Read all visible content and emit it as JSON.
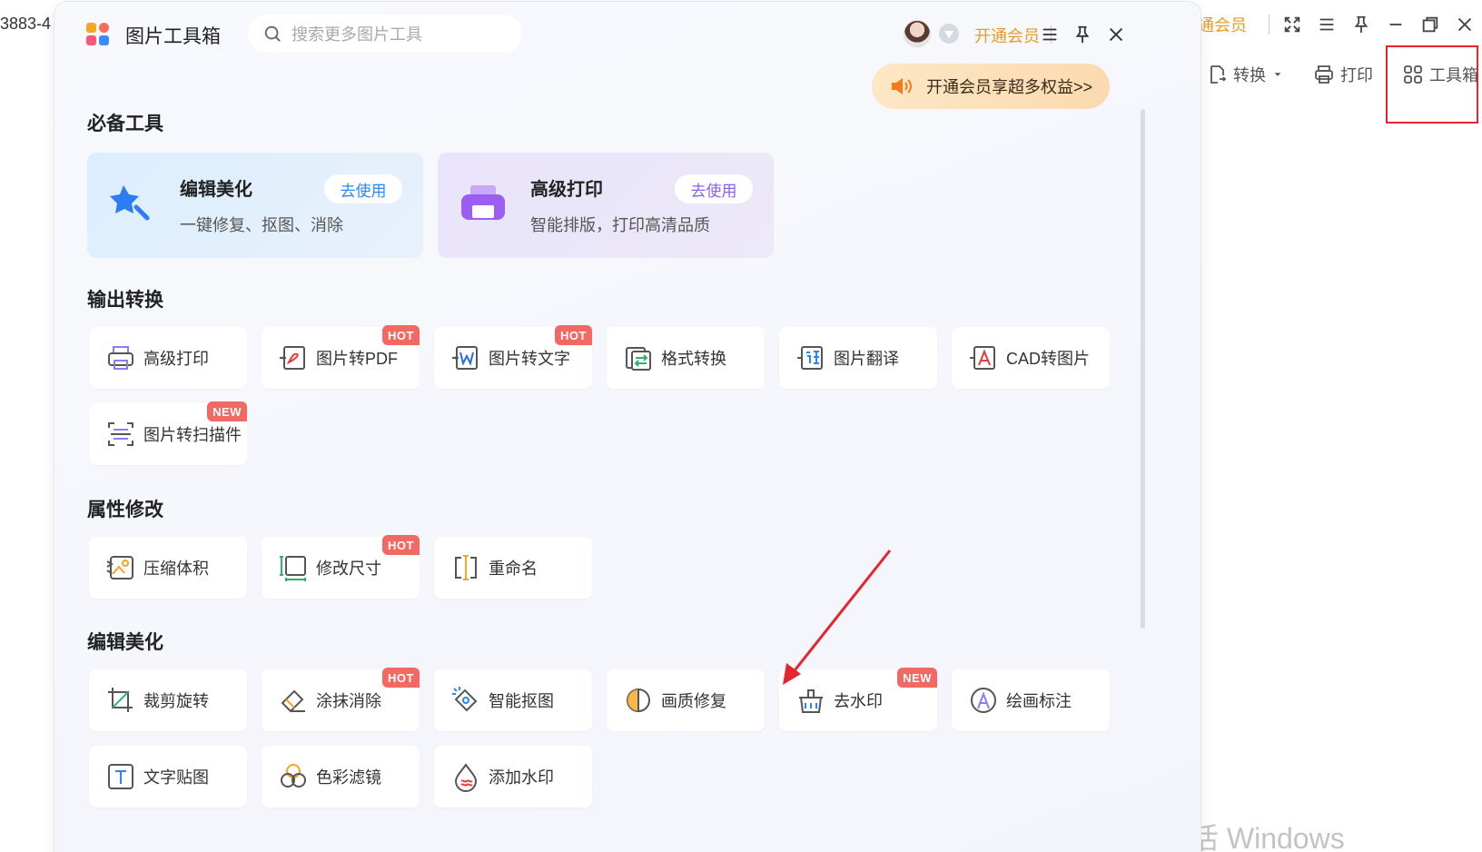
{
  "background": {
    "tab_text": "3883-4",
    "vip_label": "开通会员",
    "tools": [
      {
        "label": "转换",
        "icon": "convert-icon"
      },
      {
        "label": "打印",
        "icon": "printer-icon"
      },
      {
        "label": "工具箱",
        "icon": "toolbox-grid-icon"
      }
    ],
    "watermark": "激活 Windows"
  },
  "panel": {
    "title": "图片工具箱",
    "search_placeholder": "搜索更多图片工具",
    "vip_link": "开通会员",
    "promo": "开通会员享超多权益>>"
  },
  "sections": {
    "essential": "必备工具",
    "output": "输出转换",
    "attributes": "属性修改",
    "edit": "编辑美化"
  },
  "cards": [
    {
      "title": "编辑美化",
      "sub": "一键修复、抠图、消除",
      "button": "去使用"
    },
    {
      "title": "高级打印",
      "sub": "智能排版，打印高清品质",
      "button": "去使用"
    }
  ],
  "output_tools": [
    {
      "label": "高级打印",
      "badge": ""
    },
    {
      "label": "图片转PDF",
      "badge": "HOT"
    },
    {
      "label": "图片转文字",
      "badge": "HOT"
    },
    {
      "label": "格式转换",
      "badge": ""
    },
    {
      "label": "图片翻译",
      "badge": ""
    },
    {
      "label": "CAD转图片",
      "badge": ""
    },
    {
      "label": "图片转扫描件",
      "badge": "NEW"
    }
  ],
  "attr_tools": [
    {
      "label": "压缩体积",
      "badge": ""
    },
    {
      "label": "修改尺寸",
      "badge": "HOT"
    },
    {
      "label": "重命名",
      "badge": ""
    }
  ],
  "edit_tools": [
    {
      "label": "裁剪旋转",
      "badge": ""
    },
    {
      "label": "涂抹消除",
      "badge": "HOT"
    },
    {
      "label": "智能抠图",
      "badge": ""
    },
    {
      "label": "画质修复",
      "badge": ""
    },
    {
      "label": "去水印",
      "badge": "NEW"
    },
    {
      "label": "绘画标注",
      "badge": ""
    },
    {
      "label": "文字贴图",
      "badge": ""
    },
    {
      "label": "色彩滤镜",
      "badge": ""
    },
    {
      "label": "添加水印",
      "badge": ""
    }
  ],
  "colors": {
    "vip": "#e79b2a",
    "hot_badge": "#f26863",
    "highlight": "#e5262e",
    "blue_button": "#2a86ff",
    "purple_button": "#8d5fe6"
  }
}
